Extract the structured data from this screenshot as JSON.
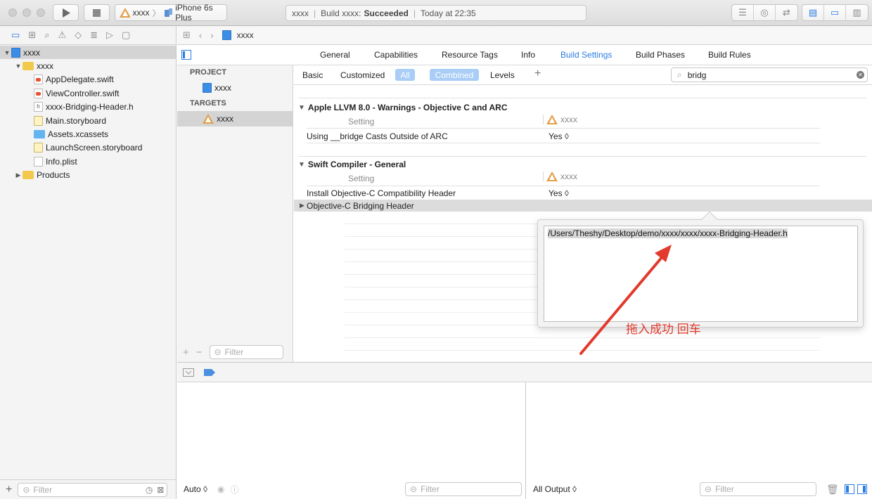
{
  "toolbar": {
    "scheme_name": "xxxx",
    "scheme_separator": "〉",
    "device": "iPhone 6s Plus",
    "activity_project": "xxxx",
    "activity_build_prefix": "Build xxxx:",
    "activity_build_status": "Succeeded",
    "activity_time": "Today at 22:35"
  },
  "navigator": {
    "items": [
      {
        "label": "xxxx",
        "icon": "project-icon",
        "depth": 0,
        "disclosure": "▼",
        "selected": true
      },
      {
        "label": "xxxx",
        "icon": "folder-icon",
        "depth": 1,
        "disclosure": "▼"
      },
      {
        "label": "AppDelegate.swift",
        "icon": "swift-file-icon",
        "depth": 2
      },
      {
        "label": "ViewController.swift",
        "icon": "swift-file-icon",
        "depth": 2
      },
      {
        "label": "xxxx-Bridging-Header.h",
        "icon": "header-file-icon",
        "depth": 2
      },
      {
        "label": "Main.storyboard",
        "icon": "storyboard-file-icon",
        "depth": 2
      },
      {
        "label": "Assets.xcassets",
        "icon": "assets-folder-icon",
        "depth": 2
      },
      {
        "label": "LaunchScreen.storyboard",
        "icon": "storyboard-file-icon",
        "depth": 2
      },
      {
        "label": "Info.plist",
        "icon": "plist-file-icon",
        "depth": 2
      },
      {
        "label": "Products",
        "icon": "folder-icon",
        "depth": 1,
        "disclosure": "▶"
      }
    ],
    "filter_placeholder": "Filter"
  },
  "jumpbar": {
    "file": "xxxx"
  },
  "editor_tabs": [
    {
      "label": "General"
    },
    {
      "label": "Capabilities"
    },
    {
      "label": "Resource Tags"
    },
    {
      "label": "Info"
    },
    {
      "label": "Build Settings",
      "active": true
    },
    {
      "label": "Build Phases"
    },
    {
      "label": "Build Rules"
    }
  ],
  "targets_panel": {
    "project_header": "PROJECT",
    "project_item": "xxxx",
    "targets_header": "TARGETS",
    "target_item": "xxxx",
    "filter_placeholder": "Filter"
  },
  "filter_bar": {
    "basic": "Basic",
    "customized": "Customized",
    "all": "All",
    "combined": "Combined",
    "levels": "Levels",
    "search_value": "bridg"
  },
  "sections": {
    "llvm": {
      "title": "Apple LLVM 8.0 - Warnings - Objective C and ARC",
      "col_setting": "Setting",
      "col_target": "xxxx",
      "row_label": "Using __bridge Casts Outside of ARC",
      "row_value": "Yes ◊"
    },
    "swift": {
      "title": "Swift Compiler - General",
      "col_setting": "Setting",
      "col_target": "xxxx",
      "row1_label": "Install Objective-C Compatibility Header",
      "row1_value": "Yes ◊",
      "row2_label": "Objective-C Bridging Header"
    }
  },
  "popover": {
    "value": "/Users/Theshy/Desktop/demo/xxxx/xxxx/xxxx-Bridging-Header.h"
  },
  "annotation": {
    "text": "拖入成功  回车",
    "color": "#e23a2c"
  },
  "debug": {
    "auto_label": "Auto ◊",
    "vars_filter_placeholder": "Filter",
    "output_label": "All Output ◊",
    "console_filter_placeholder": "Filter"
  },
  "colors": {
    "accent": "#2a7de1",
    "pill": "#a9cdf6",
    "selection": "#d4d4d4"
  }
}
